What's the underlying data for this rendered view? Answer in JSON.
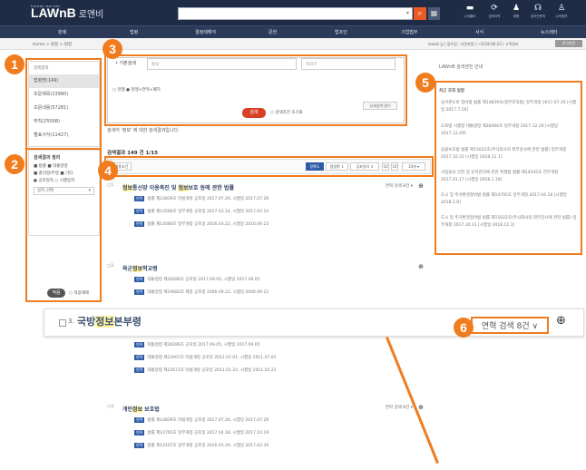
{
  "app": {
    "brand_small": "Korean law info",
    "brand": "LAWnB",
    "brand_ko": "로앤비"
  },
  "topbar": {
    "search_value": "",
    "icons": [
      {
        "name": "folder-icon",
        "label": "나의폴더"
      },
      {
        "name": "history-icon",
        "label": "검색이력"
      },
      {
        "name": "person-icon",
        "label": "회원"
      },
      {
        "name": "headset-icon",
        "label": "온라인문의"
      },
      {
        "name": "user-icon",
        "label": "나의정보"
      }
    ]
  },
  "nav": [
    "판례",
    "법령",
    "결정례해석",
    "문헌",
    "법조인",
    "기업법무",
    "서식",
    "뉴스레터"
  ],
  "breadcrumb": "Home > 법령 > 법령",
  "breadcrumb_right": "lawnb 님 | 접속일 : 자문회원 | ~2018-06-22 | 고객센터",
  "breadcrumb_tag": "로그아웃",
  "left": {
    "header": "검색결과",
    "items": [
      "법령명(149)",
      "조문제목(23990)",
      "조문내용(57281)",
      "부칙(25008)",
      "별표서식(11427)"
    ],
    "filter_title": "검색결과 정리",
    "chk1": "■ 법률  ■ 대통령령",
    "chk2": "■ 총리령/부령  ■ 기타",
    "chk3": "● 공포일자  ○ 시행일자",
    "select": "일자 선택",
    "apply": "적용",
    "reset": "○ 적용해제"
  },
  "searchbox": {
    "label": "• 기본검색",
    "keyword": "정보",
    "placeholder": "제외어",
    "scope": "○ 현행  ● 현행+연혁+폐지",
    "detail": "상세검색 열기",
    "button": "검색",
    "reset": "○ 검색조건 초기화"
  },
  "hint": "검색어 '정보' 에 대한 검색결과입니다.",
  "count": "검색결과 149 건 1/15",
  "toolbar": {
    "chip": "이용조건",
    "sorts": [
      "정확도",
      "법령명 ↕",
      "공포일자 ↕",
      "10",
      "10",
      "10개 ▾"
    ]
  },
  "results": [
    {
      "num": "□1.",
      "title_pre": "",
      "title_hl": "정보",
      "title_mid": "통신망 이용촉진 및 ",
      "title_hl2": "정보",
      "title_post": "보호 등에 관한 법률",
      "link": "연혁 검색 8건 ▾",
      "subs": [
        "법률 제14839호 타법개정 공포일 2017.07.26, 시행일 2017.07.26",
        "법률 제14580호 일부개정 공포일 2017.03.14, 시행일 2017.03.14",
        "법률 제14080호 일부개정 공포일 2016.03.22, 시행일 2016.09.23"
      ]
    },
    {
      "num": "□2.",
      "title_pre": "육군",
      "title_hl": "정보",
      "title_mid": "학교령",
      "title_hl2": "",
      "title_post": "",
      "link": "",
      "subs": [
        "대통령령 제28286호 공포일 2017.09.05, 시행일 2017.09.05",
        "대통령령 제19682호 제정 공포일 2006.09.22, 시행일 2006.09.22"
      ]
    },
    {
      "num": "□3.",
      "title_pre": "국방",
      "title_hl": "정보",
      "title_mid": "본부령",
      "title_hl2": "",
      "title_post": "",
      "link": "연혁 검색 8건 ▾",
      "subs": [
        "대통령령 제28286호 공포일 2017.09.05, 시행일 2017.09.05",
        "대통령령 제23007호 타법개정 공포일 2011.07.01, 시행일 2011.07.01",
        "대통령령 제22672호 타법개정 공포일 2011.02.22, 시행일 2011.02.22"
      ]
    },
    {
      "num": "□4.",
      "title_pre": "개인",
      "title_hl": "정보",
      "title_mid": " 보호법",
      "title_hl2": "",
      "title_post": "",
      "link": "연혁 검색 8건 ▾",
      "subs": [
        "법률 제14839호 타법개정 공포일 2017.07.26, 시행일 2017.07.26",
        "법률 제14765호 일부개정 공포일 2017.04.18, 시행일 2017.10.19",
        "법률 제14107호 일부개정 공포일 2016.03.29, 시행일 2017.03.30"
      ]
    }
  ],
  "zoom": {
    "num": "3.",
    "title_pre": "국방",
    "title_hl": "정보",
    "title_post": "본부령",
    "link": "연혁 검색 8건 ∨"
  },
  "right": {
    "header": "LAWnB 검색엔진 안내",
    "title": "최근 조회 법령",
    "laws": [
      "농어촌도로 정비법 법률 제14839호(정부조직법) 일부개정 2017.07.26 [시행일 2017.7.26]",
      "도로법 시행령 대통령령 제28466호 일부개정 2017.12.29 [시행일 2017.12.29]",
      "동물보호법 법률 제15022호(주식회사의 외부감사에 관한 법률) 일부개정 2017.10.31 [시행일 2018.11.1]",
      "사업들의 안전 및 유지관리에 관한 특별법 법률 제14545호 전부개정 2017.01.17 [시행일 2018.1.18]",
      "도시 및 주거환경정비법 법률 제14795호 일부개정 2017.04.18 [시행일 2018.2.9]",
      "도시 및 주거환경정비법 법률 제15022호(주식회사의 외부감사에 관한 법률) 일부개정 2017.10.31 [시행일 2018.11.1]"
    ]
  },
  "callouts": [
    "1",
    "2",
    "3",
    "4",
    "5",
    "6"
  ],
  "colors": {
    "accent": "#f07c1e",
    "header": "#1e2c46",
    "highlight": "#fff39c",
    "link": "#2d5ba8"
  }
}
